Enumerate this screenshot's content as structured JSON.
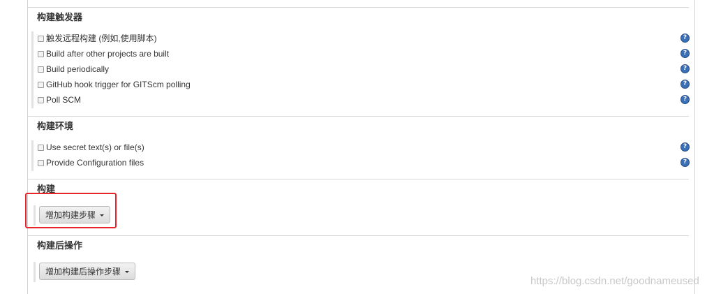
{
  "triggers": {
    "title": "构建触发器",
    "options": [
      {
        "label": "触发远程构建 (例如,使用脚本)",
        "checked": false
      },
      {
        "label": "Build after other projects are built",
        "checked": false
      },
      {
        "label": "Build periodically",
        "checked": false
      },
      {
        "label": "GitHub hook trigger for GITScm polling",
        "checked": false
      },
      {
        "label": "Poll SCM",
        "checked": false
      }
    ]
  },
  "environment": {
    "title": "构建环境",
    "options": [
      {
        "label": "Use secret text(s) or file(s)",
        "checked": false
      },
      {
        "label": "Provide Configuration files",
        "checked": false
      }
    ]
  },
  "build": {
    "title": "构建",
    "add_step_label": "增加构建步骤"
  },
  "post_build": {
    "title": "构建后操作",
    "add_step_label": "增加构建后操作步骤"
  },
  "help_icon_glyph": "?",
  "highlight_color": "#e8242a",
  "watermark": "https://blog.csdn.net/goodnameused"
}
